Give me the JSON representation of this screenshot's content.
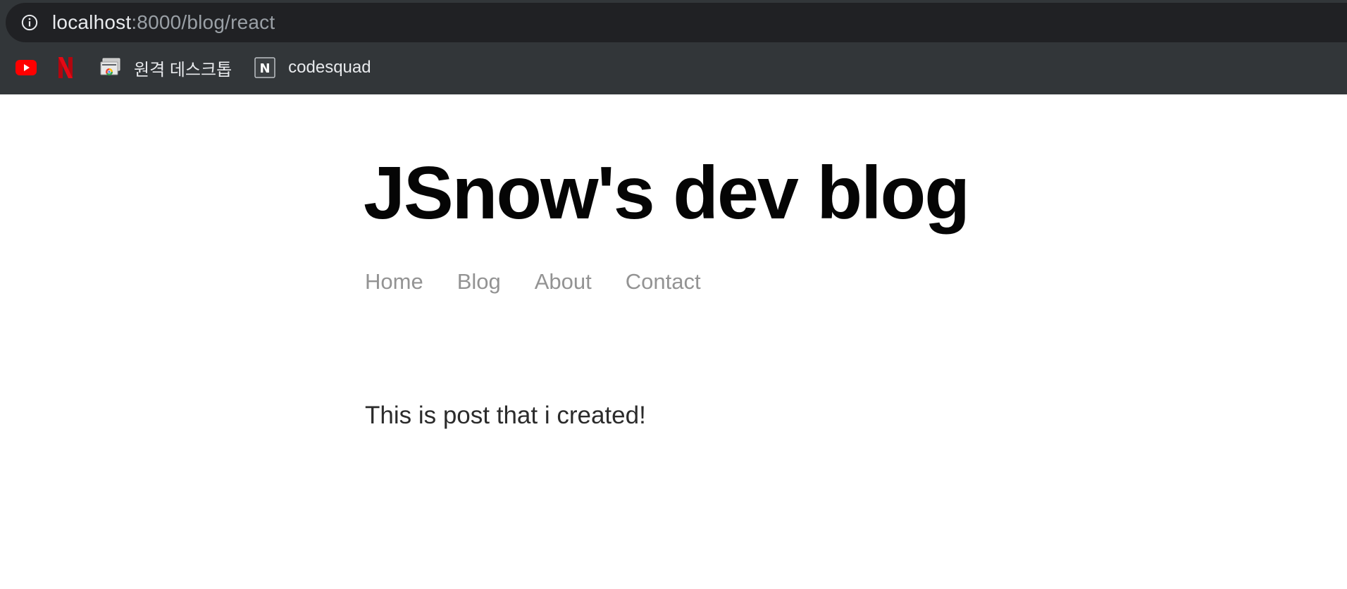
{
  "browser": {
    "url_host": "localhost",
    "url_rest": ":8000/blog/react",
    "bookmarks": [
      {
        "label": "",
        "icon": "youtube-icon"
      },
      {
        "label": "",
        "icon": "netflix-icon"
      },
      {
        "label": "원격 데스크톱",
        "icon": "remote-desktop-icon"
      },
      {
        "label": "codesquad",
        "icon": "notion-icon"
      }
    ]
  },
  "site": {
    "title": "JSnow's dev blog",
    "nav": [
      "Home",
      "Blog",
      "About",
      "Contact"
    ]
  },
  "post": {
    "body": "This is post that i created!"
  },
  "colors": {
    "chrome_bg": "#323639",
    "address_bg": "#202124",
    "nav_text": "#939393",
    "title_text": "#050505"
  }
}
